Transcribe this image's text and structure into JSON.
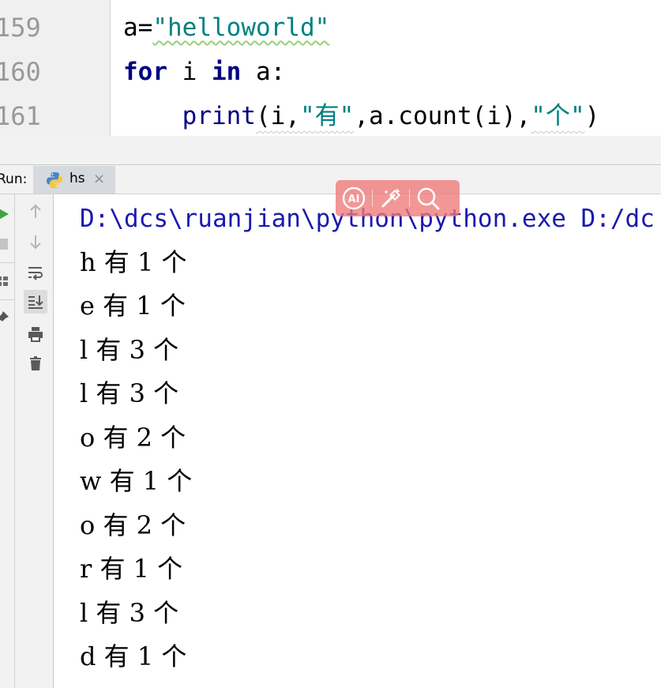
{
  "editor": {
    "line_numbers": [
      "159",
      "160",
      "161"
    ],
    "line1": {
      "var": "a",
      "op": "=",
      "string": "\"helloworld\""
    },
    "line2": {
      "kw_for": "for",
      "var": " i ",
      "kw_in": "in",
      "rest": " a:"
    },
    "line3": {
      "indent": "    ",
      "func": "print",
      "open": "(i,",
      "str1": "\"有\"",
      "mid": ",a.count(i),",
      "str2": "\"个\"",
      "close": ")"
    }
  },
  "run_window": {
    "label": "Run:",
    "tab_label": "hs",
    "tab_close": "×"
  },
  "toolbar": {
    "icons": [
      "rerun-icon",
      "stop-icon",
      "layout-icon",
      "pin-icon",
      "up-arrow-icon",
      "down-arrow-icon",
      "soft-wrap-icon",
      "scroll-to-end-icon",
      "print-icon",
      "trash-icon"
    ]
  },
  "console": {
    "command": "D:\\dcs\\ruanjian\\python\\python.exe D:/dc",
    "output": [
      "h 有 1 个",
      "e 有 1 个",
      "l 有 3 个",
      "l 有 3 个",
      "o 有 2 个",
      "w 有 1 个",
      "o 有 2 个",
      "r 有 1 个",
      "l 有 3 个",
      "d 有 1 个"
    ]
  },
  "overlay": {
    "buttons": [
      "ai-icon",
      "magic-wand-icon",
      "search-icon"
    ],
    "ai_text": "AI"
  },
  "colors": {
    "keyword": "#000080",
    "string": "#008080",
    "command": "#1a1ab0",
    "run_green": "#3fa63f",
    "overlay": "#f07878"
  }
}
